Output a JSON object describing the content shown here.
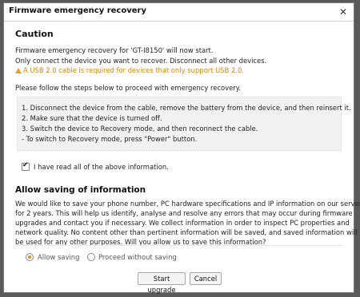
{
  "window": {
    "title": "Firmware emergency recovery",
    "close_glyph": "✕"
  },
  "caution": {
    "title": "Caution",
    "line1": "Firmware emergency recovery for 'GT-I8150' will now start.",
    "line2": "Only connect the device you want to recover. Disconnect all other devices.",
    "warning": "A USB 2.0 cable is required for devices that only support USB 2.0.",
    "instruction": "Please follow the steps below to proceed with emergency recovery."
  },
  "steps": [
    "1. Disconnect the device from the cable, remove the battery from the device, and then reinsert it.",
    "2. Make sure that the device is turned off.",
    "3. Switch the device to Recovery mode, and then reconnect the cable.",
    "- To switch to Recovery mode, press \"Power\" button."
  ],
  "acknowledge": {
    "label": "I have read all of the above information.",
    "checked": true,
    "check_glyph": "✔"
  },
  "saving": {
    "title": "Allow saving of information",
    "paragraph": [
      "We would like to save your phone number, PC hardware specifications and IP information on our server",
      "for 2 years. This will help us identify, analyse and resolve any errors that may occur during firmware",
      "upgrades and contact you if necessary. We collect information in order to inspect PC properties and",
      "network quality. No content other than pertinent information will be saved, and saved information will not",
      "be used for any other purposes. Will you allow us to save this information?"
    ],
    "options": [
      {
        "label": "Allow saving",
        "selected": true
      },
      {
        "label": "Proceed without saving",
        "selected": false
      }
    ]
  },
  "buttons": {
    "start": "Start upgrade",
    "cancel": "Cancel"
  },
  "colors": {
    "warning": "#d8860a",
    "radio_accent": "#e58a18"
  },
  "icons": [
    "close-icon",
    "warning-icon",
    "check-icon"
  ]
}
